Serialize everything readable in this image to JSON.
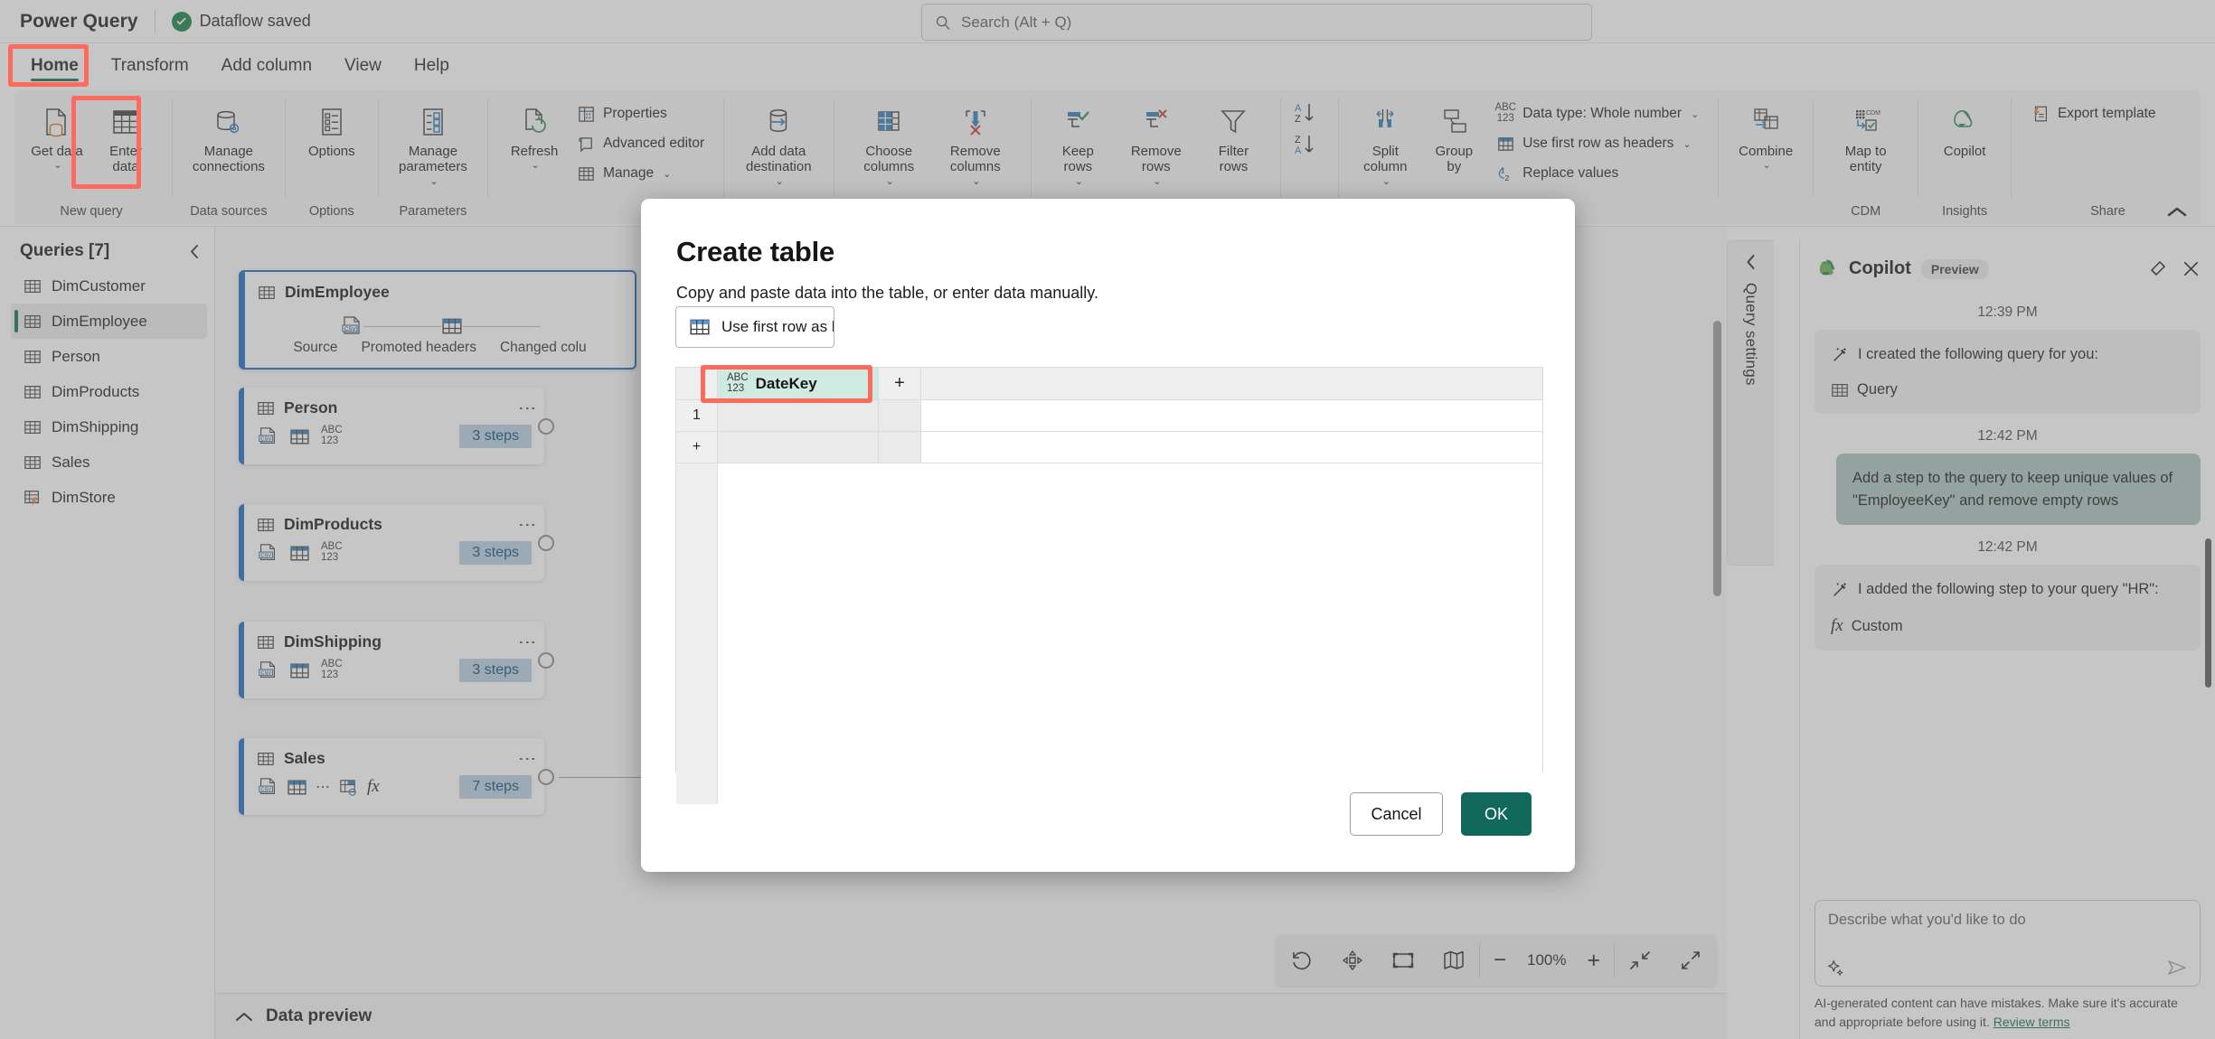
{
  "titlebar": {
    "app_title": "Power Query",
    "saved_status": "Dataflow saved",
    "search_placeholder": "Search (Alt + Q)"
  },
  "ribbon": {
    "tabs": [
      {
        "label": "Home",
        "active": true
      },
      {
        "label": "Transform",
        "active": false
      },
      {
        "label": "Add column",
        "active": false
      },
      {
        "label": "View",
        "active": false
      },
      {
        "label": "Help",
        "active": false
      }
    ],
    "groups": {
      "new_query": {
        "label": "New query",
        "get_data": "Get data",
        "enter_data": "Enter data"
      },
      "data_sources": {
        "label": "Data sources",
        "manage_connections": "Manage connections"
      },
      "options": {
        "label": "Options",
        "options": "Options"
      },
      "parameters": {
        "label": "Parameters",
        "manage_parameters": "Manage parameters"
      },
      "query": {
        "refresh": "Refresh",
        "properties": "Properties",
        "advanced_editor": "Advanced editor",
        "manage": "Manage"
      },
      "destination": {
        "add_data_destination": "Add data destination"
      },
      "columns": {
        "choose_columns": "Choose columns",
        "remove_columns": "Remove columns"
      },
      "rows": {
        "keep_rows": "Keep rows",
        "remove_rows": "Remove rows",
        "filter_rows": "Filter rows"
      },
      "transform": {
        "split_column": "Split column",
        "group_by": "Group by",
        "data_type": "Data type: Whole number",
        "use_first_row_as_headers": "Use first row as headers",
        "replace_values": "Replace values"
      },
      "combine": {
        "combine": "Combine"
      },
      "cdm": {
        "label": "CDM",
        "map_to_entity": "Map to entity"
      },
      "insights": {
        "label": "Insights",
        "copilot": "Copilot"
      },
      "share": {
        "label": "Share",
        "export_template": "Export template"
      }
    }
  },
  "queries_pane": {
    "title": "Queries [7]",
    "items": [
      {
        "label": "DimCustomer",
        "selected": false,
        "icon": "table-icon"
      },
      {
        "label": "DimEmployee",
        "selected": true,
        "icon": "table-icon"
      },
      {
        "label": "Person",
        "selected": false,
        "icon": "table-icon"
      },
      {
        "label": "DimProducts",
        "selected": false,
        "icon": "table-icon"
      },
      {
        "label": "DimShipping",
        "selected": false,
        "icon": "table-icon"
      },
      {
        "label": "Sales",
        "selected": false,
        "icon": "table-icon"
      },
      {
        "label": "DimStore",
        "selected": false,
        "icon": "table-bolt-icon"
      }
    ]
  },
  "diagram": {
    "cards": [
      {
        "name": "DimEmployee",
        "expanded": true,
        "steps": [
          "Source",
          "Promoted headers",
          "Changed colu"
        ],
        "steps_pill": ""
      },
      {
        "name": "Person",
        "expanded": false,
        "steps_pill": "3 steps"
      },
      {
        "name": "DimProducts",
        "expanded": false,
        "steps_pill": "3 steps"
      },
      {
        "name": "DimShipping",
        "expanded": false,
        "steps_pill": "3 steps"
      },
      {
        "name": "Sales",
        "expanded": false,
        "steps_pill": "7 steps"
      }
    ]
  },
  "query_settings": {
    "label": "Query settings"
  },
  "modal": {
    "title": "Create table",
    "subtitle": "Copy and paste data into the table, or enter data manually.",
    "headers_button": "Use first row as headers",
    "grid": {
      "columns": [
        {
          "name": "DateKey",
          "type_icon": "ABC123",
          "highlighted": true
        }
      ],
      "add_column_symbol": "+",
      "rows": [
        {
          "number": "1",
          "cells": [
            ""
          ]
        }
      ],
      "add_row_symbol": "+"
    },
    "cancel": "Cancel",
    "ok": "OK"
  },
  "copilot": {
    "title": "Copilot",
    "badge": "Preview",
    "messages": [
      {
        "time": "12:39 PM",
        "role": "assistant",
        "text": "I created the following query for you:",
        "chip": "Query",
        "chip_icon": "table-icon"
      },
      {
        "time": "12:42 PM",
        "role": "user",
        "text": "Add a step to the query to keep unique values of \"EmployeeKey\" and remove empty rows"
      },
      {
        "time": "12:42 PM",
        "role": "assistant",
        "text": "I added the following step to your query \"HR\":",
        "chip": "Custom",
        "chip_icon": "fx-icon"
      }
    ],
    "input_placeholder": "Describe what you'd like to do",
    "footer": "AI-generated content can have mistakes. Make sure it's accurate and appropriate before using it.",
    "footer_link": "Review terms"
  },
  "zoombar": {
    "zoom_level": "100%",
    "minus": "−",
    "plus": "+"
  },
  "data_preview": {
    "label": "Data preview"
  },
  "colors": {
    "accent_green": "#10695a",
    "highlight_red": "#ff6a5e",
    "card_blue": "#1668c1",
    "user_bubble": "#aac3bd",
    "header_cell": "#cfeae0"
  }
}
